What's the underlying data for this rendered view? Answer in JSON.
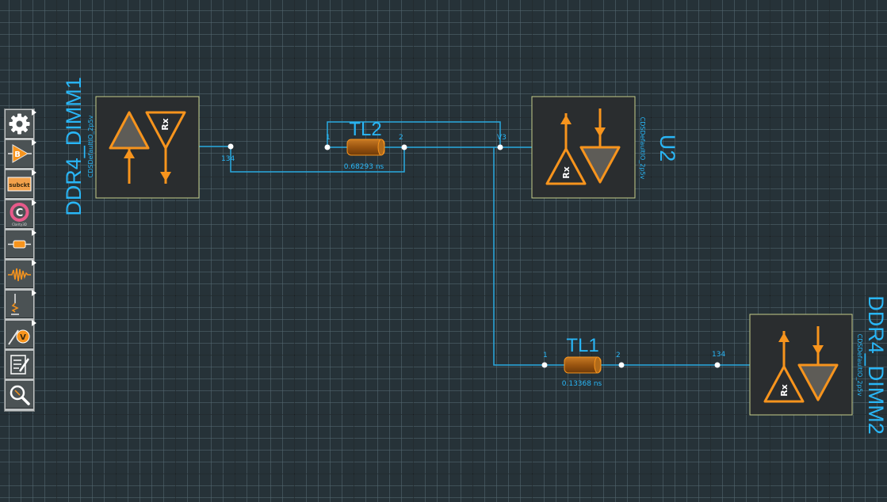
{
  "components": {
    "dimm1": {
      "name": "DDR4_DIMM1",
      "model": "CDSDefaultIO_2p5v",
      "pin": "134",
      "rx_label": "Rx"
    },
    "u2": {
      "name": "U2",
      "model": "CDSDefaultIO_2p5v",
      "pin": "V3",
      "rx_label": "Rx"
    },
    "dimm2": {
      "name": "DDR4_DIMM2",
      "model": "CDSDefaultIO_2p5v",
      "pin": "134",
      "rx_label": "Rx"
    },
    "tl2": {
      "name": "TL2",
      "delay": "0.68293 ns",
      "pin1": "1",
      "pin2": "2"
    },
    "tl1": {
      "name": "TL1",
      "delay": "0.13368 ns",
      "pin1": "1",
      "pin2": "2"
    }
  },
  "toolbar": {
    "items": [
      {
        "name": "settings",
        "icon": "gear-icon"
      },
      {
        "name": "buffer",
        "icon": "buffer-b-icon",
        "text": "B"
      },
      {
        "name": "subckt",
        "icon": "subckt-icon",
        "text": "subckt"
      },
      {
        "name": "clarity",
        "icon": "clarity-icon",
        "text": "C",
        "subtext": "Clarity3D"
      },
      {
        "name": "resistor",
        "icon": "resistor-icon"
      },
      {
        "name": "transmission-line",
        "icon": "waveform-icon"
      },
      {
        "name": "ground",
        "icon": "ground-icon"
      },
      {
        "name": "voltage-probe",
        "icon": "voltage-probe-icon",
        "text": "V"
      },
      {
        "name": "notes",
        "icon": "notes-icon"
      },
      {
        "name": "zoom",
        "icon": "zoom-icon"
      }
    ]
  },
  "colors": {
    "wire": "#29a9e0",
    "label": "#29b6f6",
    "symbol": "#f7941d",
    "border": "#c5cd8a",
    "box": "#2a2d2f",
    "tline": "#9e5a12"
  }
}
